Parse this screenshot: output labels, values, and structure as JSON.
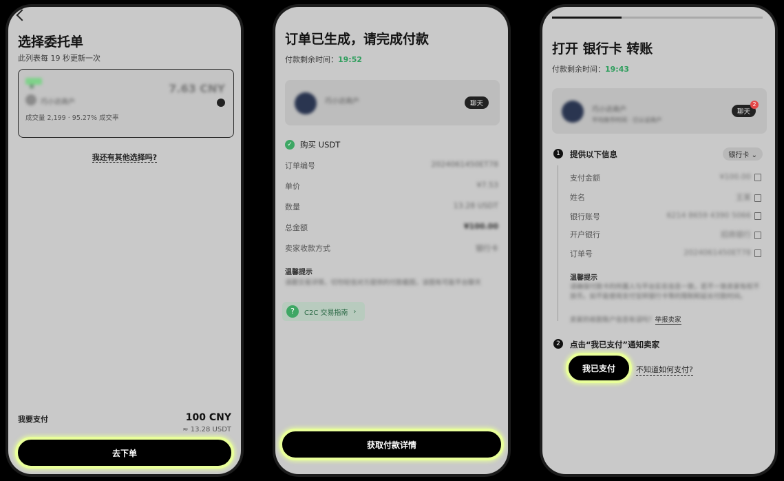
{
  "screen1": {
    "title": "选择委托单",
    "subtitle": "此列表每 19 秒更新一次",
    "ad_card": {
      "badge": "新",
      "merchant": "巧小达商户",
      "price": "7.63 CNY",
      "stats": "成交量 2,199 · 95.27% 成交率"
    },
    "other_options_link": "我还有其他选择吗?",
    "pay_label": "我要支付",
    "pay_amount": "100 CNY",
    "pay_usdt": "≈ 13.28 USDT",
    "cta": "去下单"
  },
  "screen2": {
    "title": "订单已生成，请完成付款",
    "timer_label": "付款剩余时间：",
    "timer_value": "19:52",
    "merchant": "巧小达商户",
    "chat_label": "聊天",
    "buy_label": "购买 USDT",
    "rows": [
      {
        "label": "订单编号",
        "value": "2024061450ET78"
      },
      {
        "label": "单价",
        "value": "¥7.53"
      },
      {
        "label": "数量",
        "value": "13.28 USDT"
      },
      {
        "label": "总金额",
        "value": "¥100.00"
      },
      {
        "label": "卖家收款方式",
        "value": "银行卡"
      }
    ],
    "tips_title": "温馨提示",
    "tips_text": "请跟交易详情，切勿轻信对方提供的付款截图，该图有可能平台聊天",
    "guide_label": "C2C 交易指南",
    "cta": "获取付款详情"
  },
  "screen3": {
    "title": "打开 银行卡 转账",
    "timer_label": "付款剩余时间：",
    "timer_value": "19:43",
    "merchant": "巧小达商户",
    "merchant_sub": "平均放币时间 · 已认证商户",
    "chat_label": "聊天",
    "chat_badge": "2",
    "step1_num": "1",
    "step1_title": "提供以下信息",
    "method_dropdown": "银行卡",
    "rows": [
      {
        "label": "支付金额",
        "value": "¥100.00"
      },
      {
        "label": "姓名",
        "value": "王某"
      },
      {
        "label": "银行账号",
        "value": "6214 8659 4390 5066"
      },
      {
        "label": "开户银行",
        "value": "招商银行"
      },
      {
        "label": "订单号",
        "value": "2024061450ET78"
      }
    ],
    "tips_title": "温馨提示",
    "tips_text": "请确保付款卡的所属人与平台实名信息一致，若不一致卖家有权不放币。如不能使用支付宝转银行卡等的限制和延长付款时间。",
    "report_prefix": "卖家的收款账户信息有误吗？",
    "report_link": "举报卖家",
    "step2_num": "2",
    "step2_title": "点击“我已支付”通知卖家",
    "paid_button": "我已支付",
    "dunno_link": "不知道如何支付?"
  }
}
